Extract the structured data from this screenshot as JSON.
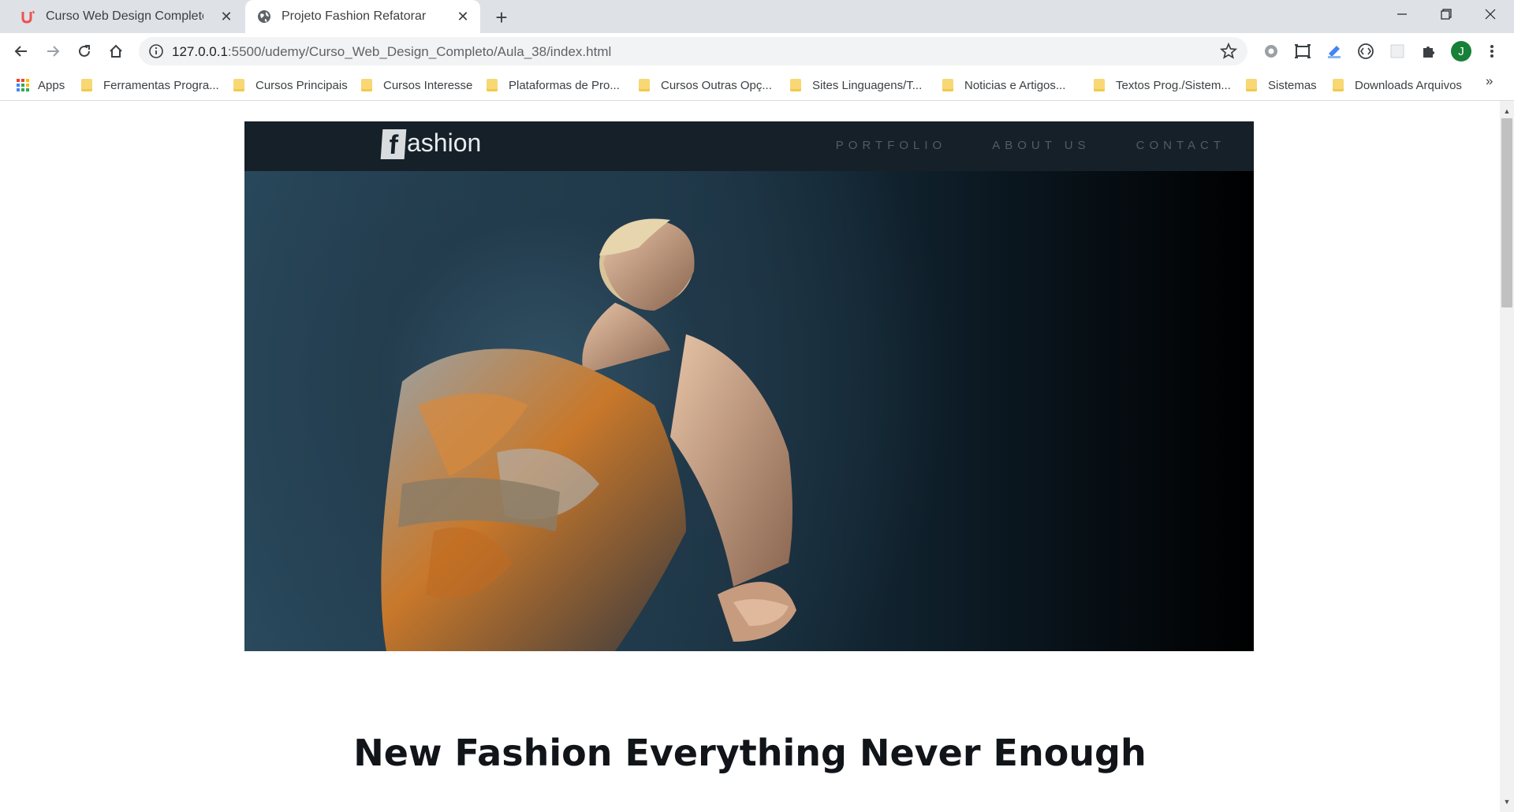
{
  "browser": {
    "tabs": [
      {
        "title": "Curso Web Design Completo: HT",
        "active": false,
        "favicon": "udemy-icon"
      },
      {
        "title": "Projeto Fashion Refatorar",
        "active": true,
        "favicon": "globe-icon"
      }
    ],
    "address": {
      "host": "127.0.0.1",
      "path": ":5500/udemy/Curso_Web_Design_Completo/Aula_38/index.html"
    },
    "profile_initial": "J",
    "bookmarks": [
      "Apps",
      "Ferramentas Progra...",
      "Cursos Principais",
      "Cursos Interesse",
      "Plataformas de Pro...",
      "Cursos Outras Opç...",
      "Sites Linguagens/T...",
      "Noticias e Artigos...",
      "Textos Prog./Sistem...",
      "Sistemas",
      "Downloads Arquivos"
    ],
    "bookmarks_more": "»"
  },
  "site": {
    "logo_letter": "f",
    "logo_text": "ashion",
    "nav": [
      "PORTFOLIO",
      "ABOUT US",
      "CONTACT"
    ],
    "headline": "New Fashion Everything Never Enough"
  },
  "colors": {
    "nav_bg": "#152029",
    "nav_link": "#4f5d68",
    "headline": "#111418",
    "tab_strip": "#dee1e6"
  }
}
